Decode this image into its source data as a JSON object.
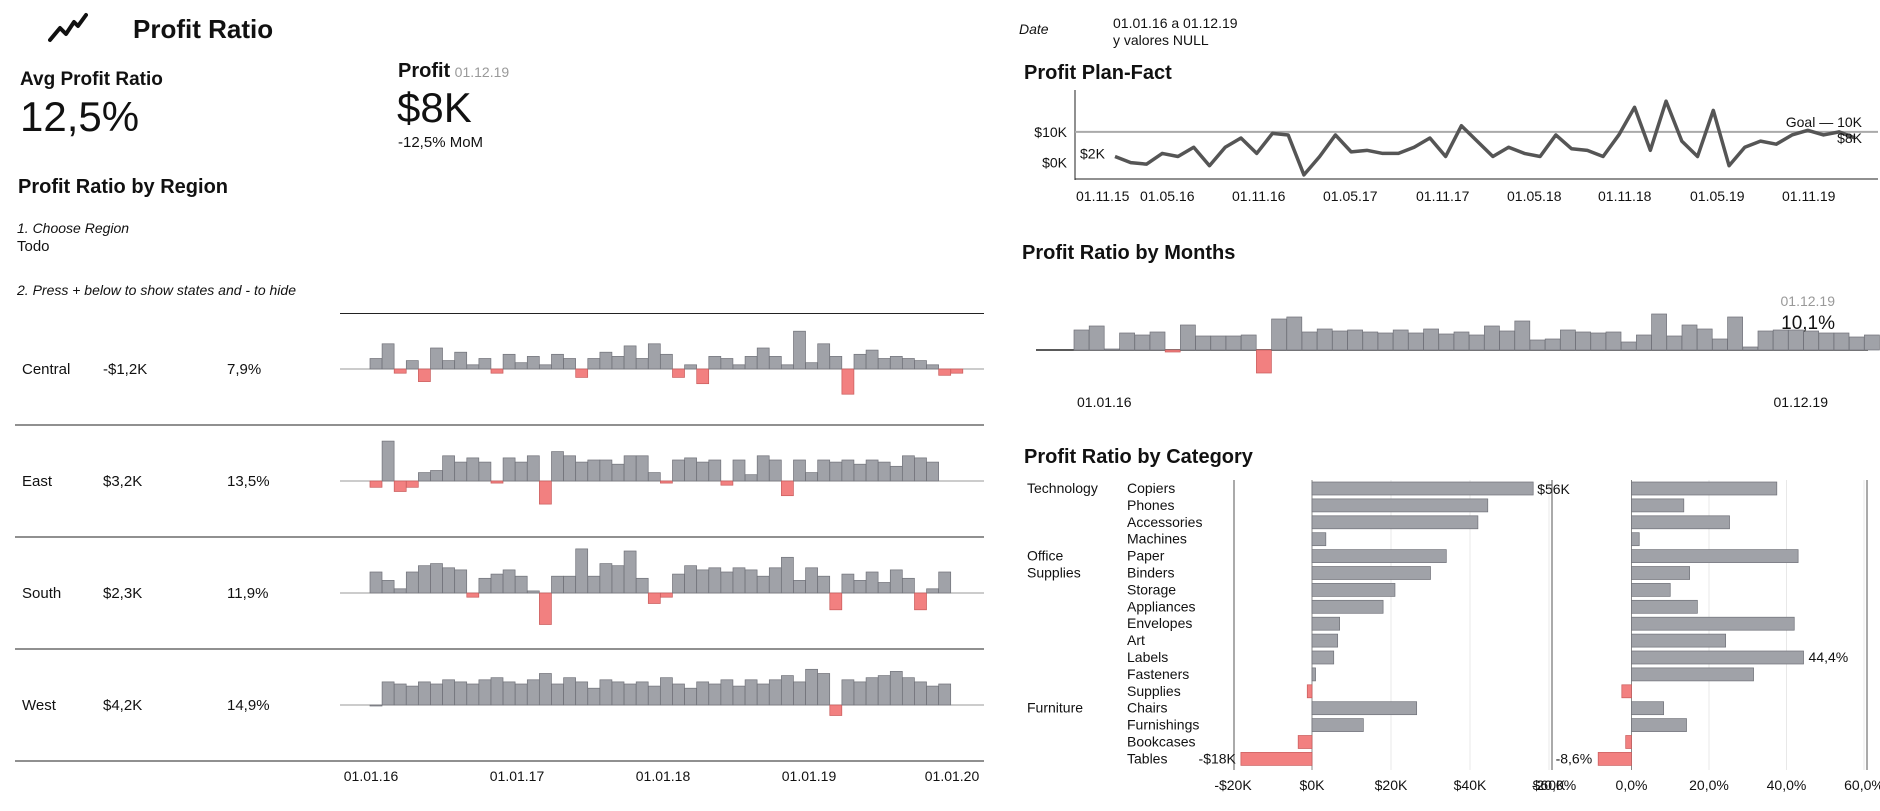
{
  "header": {
    "title": "Profit Ratio",
    "logo_icon": "trend-line-icon",
    "avg_label": "Avg Profit Ratio",
    "avg_value": "12,5%",
    "profit_label": "Profit",
    "profit_date": "01.12.19",
    "profit_value": "$8K",
    "profit_mom": "-12,5% MoM"
  },
  "filters": {
    "date_label": "Date",
    "date_value_line1": "01.01.16 a 01.12.19",
    "date_value_line2": "y valores NULL"
  },
  "region_section": {
    "title": "Profit Ratio by Region",
    "choose_label": "1. Choose Region",
    "choose_value": "Todo",
    "press_hint": "2. Press + below to show states and - to hide",
    "x_ticks": [
      "01.01.16",
      "01.01.17",
      "01.01.18",
      "01.01.19",
      "01.01.20"
    ]
  },
  "colors": {
    "bar_positive": "#a0a2a8",
    "bar_negative": "#f28080",
    "line": "#555555",
    "goal_line": "#aaaaaa"
  },
  "chart_data": [
    {
      "id": "region",
      "type": "bar",
      "title": "Profit Ratio by Region",
      "x_start": "01.01.16",
      "rows": [
        {
          "name": "Central",
          "profit": "-$1,2K",
          "ratio": "7,9%",
          "values": [
            5,
            12,
            -2,
            4,
            -6,
            10,
            4,
            8,
            2,
            5,
            -2,
            7,
            3,
            6,
            2,
            7,
            5,
            -4,
            5,
            8,
            6,
            11,
            5,
            12,
            7,
            -4,
            2,
            -7,
            6,
            5,
            2,
            6,
            10,
            6,
            2,
            18,
            3,
            12,
            6,
            -12,
            7,
            9,
            5,
            6,
            5,
            4,
            2,
            -3,
            -2
          ]
        },
        {
          "name": "East",
          "profit": "$3,2K",
          "ratio": "13,5%",
          "values": [
            -3,
            19,
            -5,
            -3,
            4,
            5,
            12,
            9,
            11,
            9,
            -1,
            11,
            9,
            12,
            -11,
            14,
            12,
            9,
            10,
            10,
            8,
            12,
            12,
            4,
            -1,
            10,
            11,
            9,
            10,
            -2,
            10,
            3,
            12,
            10,
            -7,
            10,
            4,
            10,
            9,
            10,
            8,
            10,
            9,
            7,
            12,
            11,
            9
          ]
        },
        {
          "name": "South",
          "profit": "$2,3K",
          "ratio": "11,9%",
          "values": [
            10,
            6,
            2,
            10,
            13,
            14,
            12,
            11,
            -2,
            7,
            9,
            11,
            8,
            1,
            -15,
            8,
            8,
            21,
            8,
            14,
            13,
            20,
            7,
            -5,
            -2,
            9,
            13,
            11,
            12,
            10,
            12,
            11,
            8,
            12,
            17,
            6,
            12,
            8,
            -8,
            9,
            6,
            10,
            5,
            11,
            7,
            -8,
            2,
            10
          ]
        },
        {
          "name": "West",
          "profit": "$4,2K",
          "ratio": "14,9%",
          "values": [
            0,
            11,
            10,
            9,
            11,
            10,
            12,
            11,
            10,
            12,
            13,
            11,
            10,
            12,
            15,
            10,
            13,
            11,
            8,
            12,
            11,
            10,
            11,
            9,
            13,
            10,
            8,
            11,
            10,
            12,
            9,
            12,
            10,
            12,
            14,
            11,
            17,
            15,
            -5,
            12,
            11,
            13,
            14,
            16,
            13,
            11,
            9,
            10
          ]
        }
      ],
      "ylim": [
        -20,
        20
      ]
    },
    {
      "id": "plan_fact",
      "type": "line",
      "title": "Profit Plan-Fact",
      "y_ticks": [
        "$10K",
        "$0K"
      ],
      "x_ticks": [
        "01.11.15",
        "01.05.16",
        "01.11.16",
        "01.05.17",
        "01.11.17",
        "01.05.18",
        "01.11.18",
        "01.05.19",
        "01.11.19"
      ],
      "goal_label": "Goal — 10K",
      "goal": 10000,
      "first_label": "$2K",
      "last_label": "$8K",
      "values": [
        2000,
        0,
        -500,
        3000,
        2000,
        5000,
        -1000,
        5000,
        8000,
        3000,
        9500,
        9000,
        -4000,
        2000,
        9000,
        3500,
        4000,
        3000,
        3000,
        5000,
        8000,
        2000,
        12000,
        7000,
        2000,
        5000,
        3000,
        2000,
        9000,
        4500,
        4000,
        2000,
        9000,
        18000,
        4000,
        20000,
        7000,
        2000,
        17000,
        -1000,
        5000,
        7000,
        6000,
        9000,
        10500,
        9000,
        10000,
        8000
      ],
      "ylim": [
        -5000,
        22000
      ]
    },
    {
      "id": "months",
      "type": "bar",
      "title": "Profit Ratio by Months",
      "x_start_label": "01.01.16",
      "x_end_label": "01.12.19",
      "last_date": "01.12.19",
      "last_value_label": "10,1%",
      "values": [
        20,
        24,
        1,
        17,
        15,
        18,
        -2,
        25,
        14,
        14,
        14,
        15,
        -23,
        31,
        33,
        18,
        21,
        19,
        20,
        18,
        17,
        20,
        17,
        21,
        16,
        18,
        15,
        24,
        19,
        29,
        10,
        11,
        20,
        18,
        17,
        18,
        8,
        15,
        36,
        14,
        25,
        21,
        11,
        33,
        3,
        19,
        20,
        20,
        19,
        17,
        17,
        13,
        15
      ],
      "ylim": [
        -25,
        40
      ]
    },
    {
      "id": "category",
      "type": "bar",
      "title": "Profit Ratio by Category",
      "groups": [
        {
          "name": "Technology",
          "start": 0
        },
        {
          "name": "Office",
          "start": 4
        },
        {
          "name": "Supplies",
          "start": 5
        },
        {
          "name": "Furniture",
          "start": 13
        }
      ],
      "categories": [
        "Copiers",
        "Phones",
        "Accessories",
        "Machines",
        "Paper",
        "Binders",
        "Storage",
        "Appliances",
        "Envelopes",
        "Art",
        "Labels",
        "Fasteners",
        "Supplies",
        "Chairs",
        "Furnishings",
        "Bookcases",
        "Tables"
      ],
      "profit": [
        56000,
        44500,
        42000,
        3500,
        34000,
        30000,
        21000,
        18000,
        7000,
        6500,
        5500,
        900,
        -1200,
        26500,
        13000,
        -3500,
        -18000
      ],
      "profit_ticks": [
        "-$20K",
        "$0K",
        "$20K",
        "$40K",
        "$60K"
      ],
      "profit_xlim": [
        -20000,
        60000
      ],
      "profit_max_label": "$56K",
      "profit_min_label": "-$18K",
      "ratio": [
        37.5,
        13.5,
        25.3,
        2,
        43,
        15,
        10,
        17,
        42,
        24.3,
        44.4,
        31.5,
        -2.5,
        8.3,
        14.2,
        -1.5,
        -8.6
      ],
      "ratio_ticks": [
        "-20,0%",
        "0,0%",
        "20,0%",
        "40,0%",
        "60,0%"
      ],
      "ratio_xlim": [
        -20,
        60
      ],
      "ratio_max_label": "44,4%",
      "ratio_min_label": "-8,6%"
    }
  ]
}
